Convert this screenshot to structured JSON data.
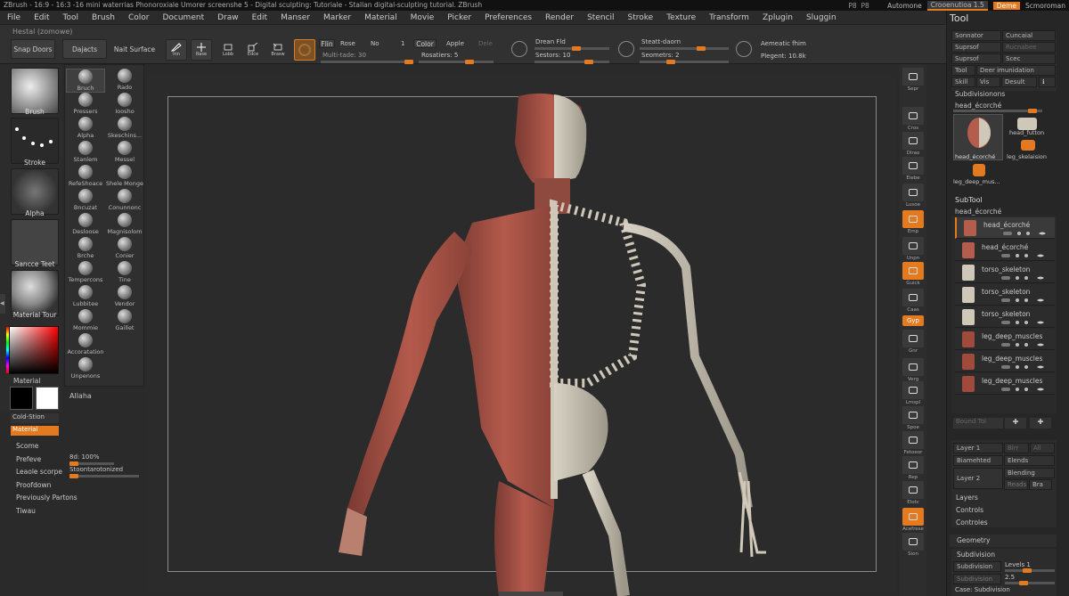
{
  "window": {
    "title": "ZBrush - 16:9 - 16:3 -16 mini waterrias Phonoroxiale Umorer screenshe 5 - Digital sculpting: Tutoriale - Stallan digital-sculpting tutorial. ZBrush",
    "right_items": [
      "Automone",
      "Crooenutioa 1.5",
      "Deme",
      "Scmoroman"
    ]
  },
  "menu": [
    "File",
    "Edit",
    "Tool",
    "Brush",
    "Color",
    "Document",
    "Draw",
    "Edit",
    "Manser",
    "Marker",
    "Material",
    "Movie",
    "Picker",
    "Preferences",
    "Render",
    "Stencil",
    "Stroke",
    "Texture",
    "Transform",
    "Zplugin",
    "Sluggin"
  ],
  "subtitle": "Hestal (zomowe)",
  "toolbar": {
    "snap_doors": "Snap Doors",
    "dajacts": "Dajacts",
    "nait_surface": "Nait Surface",
    "btn_icons": [
      "Inn",
      "Rase",
      "Lobb",
      "Edce",
      "Brasw"
    ],
    "flin": "Flin",
    "rose": "Rose",
    "no": "No",
    "one": "1",
    "color": "Color",
    "apple": "Apple",
    "dele": "Dele",
    "multi_tade": "Multi-tade: 30",
    "rosatiers": "Rosatiers: 5",
    "drean_fld": "Drean Fld",
    "sestors": "Sestors: 10",
    "steatt_daorn": "Steatt-daorn",
    "seometers": "Seometrs: 2",
    "aemeatic_fhim": "Aemeatic fhim",
    "plegent": "Plegent: 10.8k"
  },
  "left": {
    "thumbs": [
      "Brush",
      "Stroke",
      "Alpha",
      "Sancce Teet",
      "Material Tour"
    ],
    "material_label": "Material",
    "allaha": "Allaha",
    "cold_stion": "Cold-Stion",
    "material_btn": "Material",
    "menu": [
      "Scome",
      "Prefeve",
      "Leaole scorpe",
      "Proofdown",
      "Previously Partons",
      "Tiwau"
    ],
    "prefeve_val": "8d: 100%",
    "leaole_val": "Stoontarotonized"
  },
  "brushes": [
    {
      "name": "Bruch"
    },
    {
      "name": "Rado"
    },
    {
      "name": "Pressers"
    },
    {
      "name": "Ioosho"
    },
    {
      "name": "Alpha"
    },
    {
      "name": "Skeschins..."
    },
    {
      "name": "Stanlem"
    },
    {
      "name": "Messel"
    },
    {
      "name": "RefeShoace"
    },
    {
      "name": "Shele Monge"
    },
    {
      "name": "Bncuzat"
    },
    {
      "name": "Conunnonc"
    },
    {
      "name": "Desloose"
    },
    {
      "name": "Magnisolom"
    },
    {
      "name": "Brche"
    },
    {
      "name": "Conier"
    },
    {
      "name": "Tempercons"
    },
    {
      "name": "Tine"
    },
    {
      "name": "Lubbitee"
    },
    {
      "name": "Vendor"
    },
    {
      "name": "Mommie"
    },
    {
      "name": "Gaillet"
    },
    {
      "name": "Accoratation"
    },
    {
      "name": "Unpenons"
    }
  ],
  "rstrip": [
    "Sepr",
    "Cros",
    "Dlrao",
    "Eiebe",
    "Lusoe",
    "Emp",
    "Unpn",
    "Guick",
    "Caas",
    "Gyp",
    "Gnr",
    "Verg",
    "Lmspl",
    "Spoe",
    "Fetoeor",
    "Rep",
    "Elotc",
    "Acefrese",
    "Sion"
  ],
  "tool": {
    "title": "Tool",
    "rows": [
      [
        "Sonnator",
        "Cuncaial"
      ],
      [
        "Suprsof",
        "Rucnabee"
      ],
      [
        "Suprsof",
        "Scec"
      ],
      [
        "Tool",
        "Deer imunidation"
      ],
      [
        "Skill",
        "Vis",
        "Desult"
      ]
    ],
    "subdivisionons": "Subdivisionons",
    "head_slider": "head_écorché",
    "thumbs": [
      "head_écorché",
      "head_futton",
      "leg_skelaision",
      "leg_deep_mus..."
    ],
    "subtool_title": "SubTool",
    "subtool_current": "head_écorché",
    "subtools": [
      "head_écorché",
      "head_écorché",
      "torso_skeleton",
      "torso_skeleton",
      "torso_skeleton",
      "leg_deep_muscles",
      "leg_deep_muscles",
      "leg_deep_muscles"
    ],
    "bound_tol": "Bound Tol",
    "layer1": "Layer 1",
    "blrr": "Blrr",
    "all": "All",
    "biamehted": "Biamehted",
    "elends": "Elends",
    "layer2": "Layer 2",
    "blending": "Blending",
    "reads": "Reads",
    "bra": "Bra",
    "layers": "Layers",
    "controls": "Controls",
    "controles": "Controles",
    "geometry": "Geometry",
    "subdivision": "Subdivision",
    "subdivision_btn": "Subdivision",
    "levels": "Levels 1",
    "subdivision2": "Subdivision",
    "sub_val": "2.5",
    "case": "Case: Subdivision"
  },
  "colors": {
    "accent": "#e37a1f",
    "panel": "#2c2c2c",
    "canvas": "#2b2b2b"
  }
}
